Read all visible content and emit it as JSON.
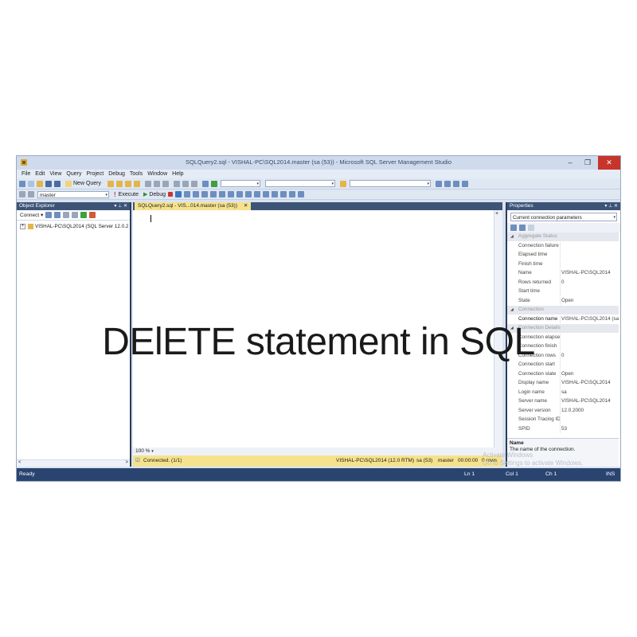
{
  "window": {
    "title": "SQLQuery2.sql - VISHAL-PC\\SQL2014.master (sa (53)) - Microsoft SQL Server Management Studio",
    "minimize": "–",
    "maximize": "❐",
    "close": "✕"
  },
  "menu": [
    "File",
    "Edit",
    "View",
    "Query",
    "Project",
    "Debug",
    "Tools",
    "Window",
    "Help"
  ],
  "toolbar": {
    "new_query": "New Query",
    "database": "master",
    "execute": "Execute",
    "debug": "Debug"
  },
  "object_explorer": {
    "title": "Object Explorer",
    "connect": "Connect ▾",
    "node": "VISHAL-PC\\SQL2014 (SQL Server 12.0.2",
    "scroll_left": "<",
    "scroll_right": ">"
  },
  "editor": {
    "tab_label": "SQLQuery2.sql - VIS...014.master (sa (53))",
    "zoom": "100 %"
  },
  "query_status": {
    "connected": "Connected. (1/1)",
    "server": "VISHAL-PC\\SQL2014 (12.0 RTM)",
    "user": "sa (53)",
    "database": "master",
    "time": "00:00:00",
    "rows": "0 rows"
  },
  "properties": {
    "title": "Properties",
    "selector": "Current connection parameters",
    "rows": [
      {
        "k": "Aggregate Status",
        "v": "",
        "cat": true
      },
      {
        "k": "Connection failure",
        "v": ""
      },
      {
        "k": "Elapsed time",
        "v": ""
      },
      {
        "k": "Finish time",
        "v": ""
      },
      {
        "k": "Name",
        "v": "VISHAL-PC\\SQL2014"
      },
      {
        "k": "Rows returned",
        "v": "0"
      },
      {
        "k": "Start time",
        "v": ""
      },
      {
        "k": "State",
        "v": "Open"
      },
      {
        "k": "Connection",
        "v": "",
        "cat": true
      },
      {
        "k": "Connection name",
        "v": "VISHAL-PC\\SQL2014 (sa",
        "bold": true
      },
      {
        "k": "Connection Details",
        "v": "",
        "cat": true
      },
      {
        "k": "Connection elapsed",
        "v": ""
      },
      {
        "k": "Connection finish",
        "v": ""
      },
      {
        "k": "Connection rows",
        "v": "0"
      },
      {
        "k": "Connection start",
        "v": ""
      },
      {
        "k": "Connection state",
        "v": "Open"
      },
      {
        "k": "Display name",
        "v": "VISHAL-PC\\SQL2014"
      },
      {
        "k": "Login name",
        "v": "sa"
      },
      {
        "k": "Server name",
        "v": "VISHAL-PC\\SQL2014"
      },
      {
        "k": "Server version",
        "v": "12.0.2000"
      },
      {
        "k": "Session Tracing ID",
        "v": ""
      },
      {
        "k": "SPID",
        "v": "53"
      }
    ],
    "desc_title": "Name",
    "desc_text": "The name of the connection."
  },
  "statusbar": {
    "ready": "Ready",
    "ln": "Ln 1",
    "col": "Col 1",
    "ch": "Ch 1",
    "ins": "INS"
  },
  "watermark": {
    "line1": "Activate Windows",
    "line2": "Go to Settings to activate Windows."
  },
  "overlay": {
    "title": "DElETE statement in SQL"
  },
  "colors": {
    "panel_header": "#3d5477",
    "tab_active": "#f6e28c",
    "statusbar": "#2a4470",
    "close_button": "#c7342a"
  }
}
